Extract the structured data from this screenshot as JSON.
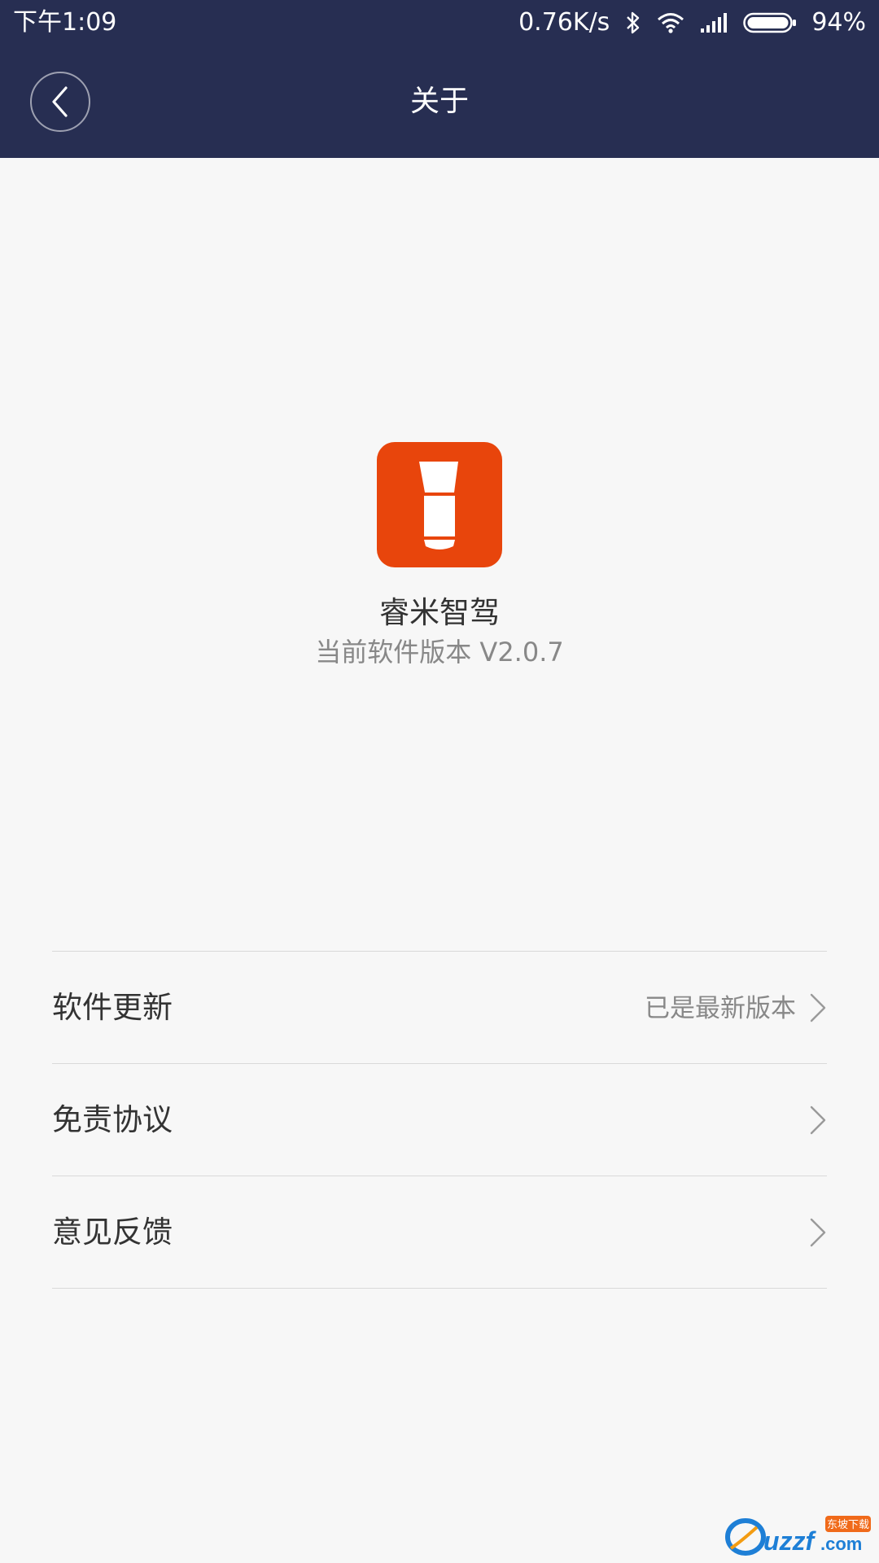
{
  "status_bar": {
    "time": "下午1:09",
    "net_speed": "0.76K/s",
    "battery": "94%",
    "icons": [
      "bluetooth-icon",
      "wifi-icon",
      "signal-icon",
      "battery-icon"
    ]
  },
  "header": {
    "title": "关于",
    "background": "#272e52"
  },
  "app": {
    "name": "睿米智驾",
    "version": "当前软件版本 V2.0.7",
    "icon_color": "#e8450c"
  },
  "menu": [
    {
      "label": "软件更新",
      "value": "已是最新版本"
    },
    {
      "label": "免责协议",
      "value": ""
    },
    {
      "label": "意见反馈",
      "value": ""
    }
  ],
  "watermark": {
    "brand": "uzzf.com",
    "tagline": "东坡下载"
  }
}
